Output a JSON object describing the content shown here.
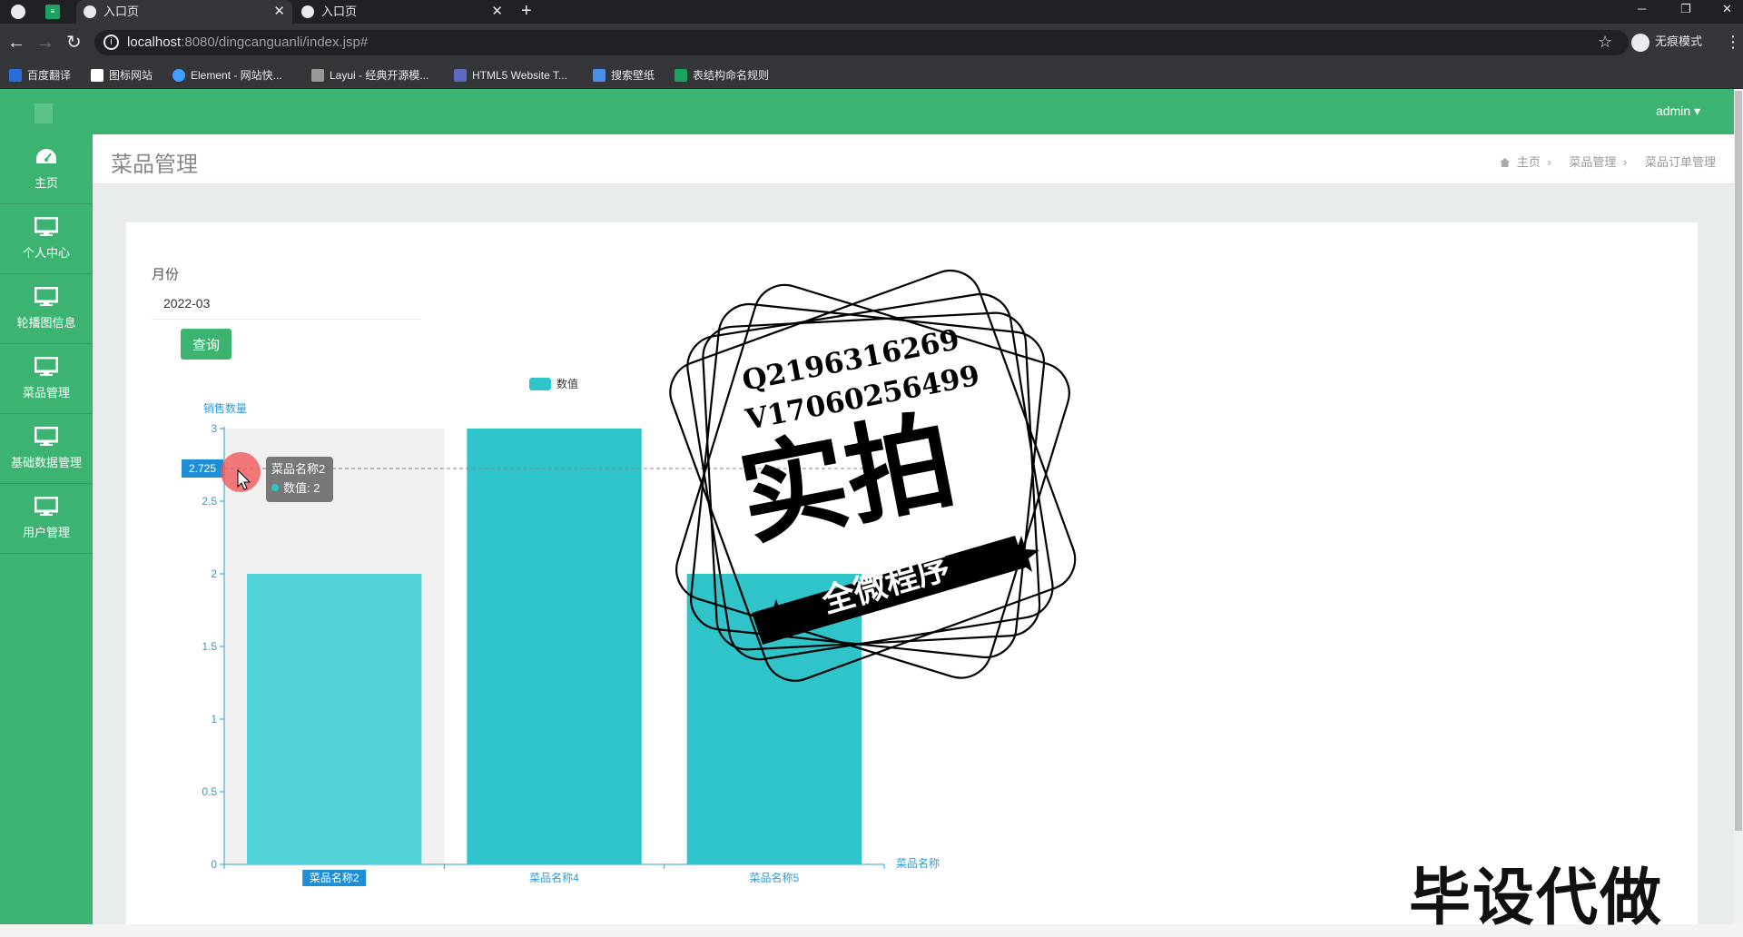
{
  "browser": {
    "tabs": [
      {
        "title": "入口页"
      },
      {
        "title": "入口页"
      }
    ],
    "url": {
      "host": "localhost",
      "path": ":8080/dingcanguanli/index.jsp#"
    },
    "incognito_label": "无痕模式",
    "bookmarks": [
      "百度翻译",
      "图标网站",
      "Element - 网站快...",
      "Layui - 经典开源模...",
      "HTML5 Website T...",
      "搜索壁纸",
      "表结构命名规则"
    ]
  },
  "header": {
    "user": "admin"
  },
  "sidebar": {
    "items": [
      {
        "label": "主页",
        "icon": "dashboard-icon"
      },
      {
        "label": "个人中心",
        "icon": "monitor-icon"
      },
      {
        "label": "轮播图信息",
        "icon": "monitor-icon"
      },
      {
        "label": "菜品管理",
        "icon": "monitor-icon"
      },
      {
        "label": "基础数据管理",
        "icon": "monitor-icon"
      },
      {
        "label": "用户管理",
        "icon": "monitor-icon"
      }
    ]
  },
  "page": {
    "title": "菜品管理",
    "breadcrumb": [
      "主页",
      "菜品管理",
      "菜品订单管理"
    ]
  },
  "form": {
    "month_label": "月份",
    "month_value": "2022-03",
    "query_button": "查询"
  },
  "chart_data": {
    "type": "bar",
    "categories": [
      "菜品名称2",
      "菜品名称4",
      "菜品名称5"
    ],
    "series": [
      {
        "name": "数值",
        "values": [
          2,
          3,
          2
        ]
      }
    ],
    "xlabel": "菜品名称",
    "ylabel": "销售数量",
    "ylim": [
      0,
      3
    ],
    "yticks": [
      "0",
      "0.5",
      "1",
      "1.5",
      "2",
      "2.5",
      "3"
    ],
    "legend": "top-center",
    "color": "#2ec4c9",
    "axis_pointer_value": "2.725",
    "tooltip": {
      "title": "菜品名称2",
      "line": "数值: 2"
    }
  },
  "watermark": {
    "contact_q": "Q2196316269",
    "contact_v": "V17060256499",
    "main": "实拍",
    "ribbon": "全微程序",
    "bottom": "毕设代做"
  }
}
